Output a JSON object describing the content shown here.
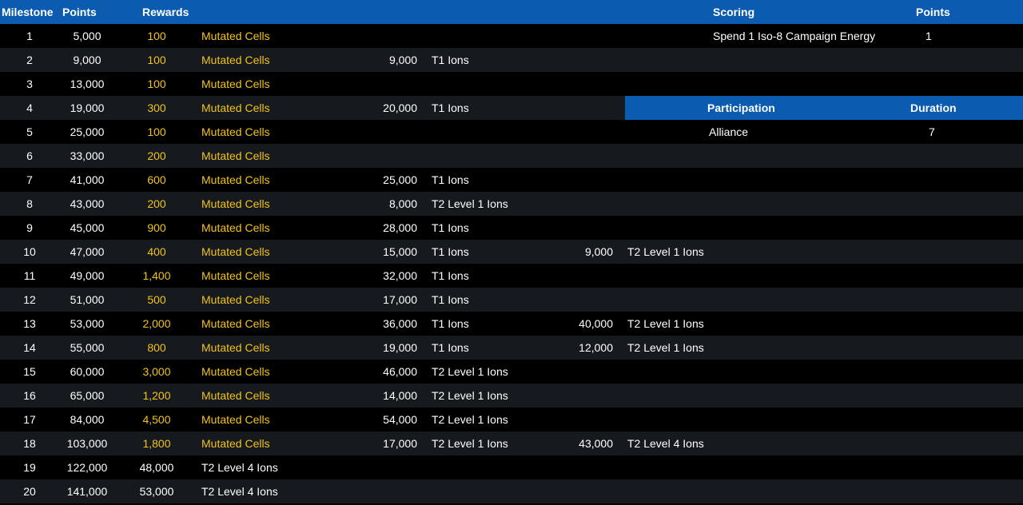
{
  "header": {
    "milestone": "Milestone",
    "points": "Points",
    "rewards": "Rewards",
    "scoring": "Scoring",
    "scoring_points": "Points"
  },
  "scoring": {
    "label": "Spend 1 Iso-8 Campaign Energy",
    "points": "1"
  },
  "participation": {
    "header": "Participation",
    "duration_header": "Duration",
    "type": "Alliance",
    "duration": "7"
  },
  "colors": {
    "header_bg": "#0b5cb0",
    "row_dark": "#000000",
    "row_alt": "#16191d",
    "reward_gold": "#f2c31b"
  },
  "rows": [
    {
      "milestone": "1",
      "points": "5,000",
      "r1_qty": "100",
      "r1_name": "Mutated Cells",
      "r1_gold": true,
      "r2_qty": "",
      "r2_name": "",
      "r3_qty": "",
      "r3_name": ""
    },
    {
      "milestone": "2",
      "points": "9,000",
      "r1_qty": "100",
      "r1_name": "Mutated Cells",
      "r1_gold": true,
      "r2_qty": "9,000",
      "r2_name": "T1 Ions",
      "r3_qty": "",
      "r3_name": ""
    },
    {
      "milestone": "3",
      "points": "13,000",
      "r1_qty": "100",
      "r1_name": "Mutated Cells",
      "r1_gold": true,
      "r2_qty": "",
      "r2_name": "",
      "r3_qty": "",
      "r3_name": ""
    },
    {
      "milestone": "4",
      "points": "19,000",
      "r1_qty": "300",
      "r1_name": "Mutated Cells",
      "r1_gold": true,
      "r2_qty": "20,000",
      "r2_name": "T1 Ions",
      "r3_qty": "",
      "r3_name": ""
    },
    {
      "milestone": "5",
      "points": "25,000",
      "r1_qty": "100",
      "r1_name": "Mutated Cells",
      "r1_gold": true,
      "r2_qty": "",
      "r2_name": "",
      "r3_qty": "",
      "r3_name": ""
    },
    {
      "milestone": "6",
      "points": "33,000",
      "r1_qty": "200",
      "r1_name": "Mutated Cells",
      "r1_gold": true,
      "r2_qty": "",
      "r2_name": "",
      "r3_qty": "",
      "r3_name": ""
    },
    {
      "milestone": "7",
      "points": "41,000",
      "r1_qty": "600",
      "r1_name": "Mutated Cells",
      "r1_gold": true,
      "r2_qty": "25,000",
      "r2_name": "T1 Ions",
      "r3_qty": "",
      "r3_name": ""
    },
    {
      "milestone": "8",
      "points": "43,000",
      "r1_qty": "200",
      "r1_name": "Mutated Cells",
      "r1_gold": true,
      "r2_qty": "8,000",
      "r2_name": "T2 Level 1 Ions",
      "r3_qty": "",
      "r3_name": ""
    },
    {
      "milestone": "9",
      "points": "45,000",
      "r1_qty": "900",
      "r1_name": "Mutated Cells",
      "r1_gold": true,
      "r2_qty": "28,000",
      "r2_name": "T1 Ions",
      "r3_qty": "",
      "r3_name": ""
    },
    {
      "milestone": "10",
      "points": "47,000",
      "r1_qty": "400",
      "r1_name": "Mutated Cells",
      "r1_gold": true,
      "r2_qty": "15,000",
      "r2_name": "T1 Ions",
      "r3_qty": "9,000",
      "r3_name": "T2 Level 1 Ions"
    },
    {
      "milestone": "11",
      "points": "49,000",
      "r1_qty": "1,400",
      "r1_name": "Mutated Cells",
      "r1_gold": true,
      "r2_qty": "32,000",
      "r2_name": "T1 Ions",
      "r3_qty": "",
      "r3_name": ""
    },
    {
      "milestone": "12",
      "points": "51,000",
      "r1_qty": "500",
      "r1_name": "Mutated Cells",
      "r1_gold": true,
      "r2_qty": "17,000",
      "r2_name": "T1 Ions",
      "r3_qty": "",
      "r3_name": ""
    },
    {
      "milestone": "13",
      "points": "53,000",
      "r1_qty": "2,000",
      "r1_name": "Mutated Cells",
      "r1_gold": true,
      "r2_qty": "36,000",
      "r2_name": "T1 Ions",
      "r3_qty": "40,000",
      "r3_name": "T2 Level 1 Ions"
    },
    {
      "milestone": "14",
      "points": "55,000",
      "r1_qty": "800",
      "r1_name": "Mutated Cells",
      "r1_gold": true,
      "r2_qty": "19,000",
      "r2_name": "T1 Ions",
      "r3_qty": "12,000",
      "r3_name": "T2 Level 1 Ions"
    },
    {
      "milestone": "15",
      "points": "60,000",
      "r1_qty": "3,000",
      "r1_name": "Mutated Cells",
      "r1_gold": true,
      "r2_qty": "46,000",
      "r2_name": "T2 Level 1 Ions",
      "r3_qty": "",
      "r3_name": ""
    },
    {
      "milestone": "16",
      "points": "65,000",
      "r1_qty": "1,200",
      "r1_name": "Mutated Cells",
      "r1_gold": true,
      "r2_qty": "14,000",
      "r2_name": "T2 Level 1 Ions",
      "r3_qty": "",
      "r3_name": ""
    },
    {
      "milestone": "17",
      "points": "84,000",
      "r1_qty": "4,500",
      "r1_name": "Mutated Cells",
      "r1_gold": true,
      "r2_qty": "54,000",
      "r2_name": "T2 Level 1 Ions",
      "r3_qty": "",
      "r3_name": ""
    },
    {
      "milestone": "18",
      "points": "103,000",
      "r1_qty": "1,800",
      "r1_name": "Mutated Cells",
      "r1_gold": true,
      "r2_qty": "17,000",
      "r2_name": "T2 Level 1 Ions",
      "r3_qty": "43,000",
      "r3_name": "T2 Level 4 Ions"
    },
    {
      "milestone": "19",
      "points": "122,000",
      "r1_qty": "48,000",
      "r1_name": "T2 Level 4 Ions",
      "r1_gold": false,
      "r2_qty": "",
      "r2_name": "",
      "r3_qty": "",
      "r3_name": ""
    },
    {
      "milestone": "20",
      "points": "141,000",
      "r1_qty": "53,000",
      "r1_name": "T2 Level 4 Ions",
      "r1_gold": false,
      "r2_qty": "",
      "r2_name": "",
      "r3_qty": "",
      "r3_name": ""
    }
  ]
}
